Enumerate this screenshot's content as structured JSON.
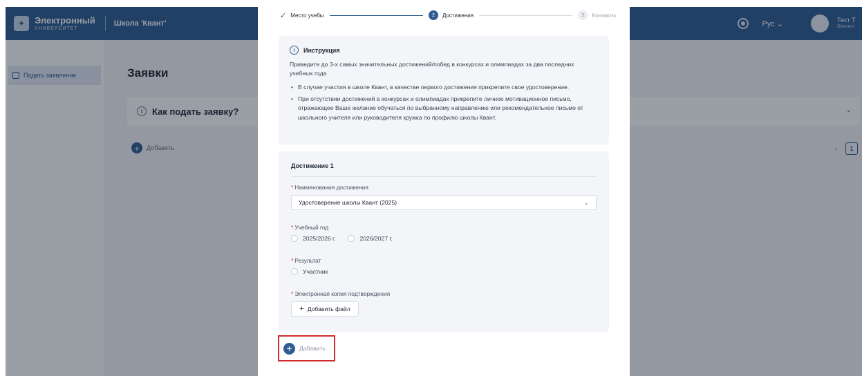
{
  "header": {
    "logo_title": "Электронный",
    "logo_subtitle": "УНИВЕРСИТЕТ",
    "school": "Школа 'Квант'",
    "language": "Рус ⌄",
    "user_name": "Тест Т",
    "user_sub": "Школьн"
  },
  "sidebar": {
    "items": [
      {
        "label": "Подать заявление"
      }
    ]
  },
  "background": {
    "page_title": "Заявки",
    "how_to_apply": "Как подать заявку?",
    "add_label": "Добавить",
    "pager_prev": "‹",
    "page_number": "1"
  },
  "stepper": {
    "steps": [
      {
        "label": "Место учебы",
        "state": "done"
      },
      {
        "number": "2",
        "label": "Достижения",
        "state": "active"
      },
      {
        "number": "3",
        "label": "Контакты",
        "state": "pending"
      }
    ]
  },
  "instructions": {
    "title": "Инструкция",
    "intro": "Приведите до 3-х самых значительных достижений/побед в конкурсах и олимпиадах за два последних учебных года",
    "bullets": [
      "В случае участия в школе Квант, в качестве первого достижения прикрепите свое удостоверение.",
      "При отсутствии достижений в конкурсах и олимпиадах прикрепите личное мотивационное письмо, отражающее Ваше желание обучаться по выбранному направлению или рекомендательное письмо от школьного учителя или руководителя кружка по профилю школы Квант."
    ]
  },
  "achievement": {
    "title": "Достижение 1",
    "name_label": "Наименования достижения",
    "name_value": "Удостоверение школы Квант (2025)",
    "year_label": "Учебный год",
    "year_options": [
      "2025/2026 г.",
      "2026/2027 г."
    ],
    "result_label": "Результат",
    "result_options": [
      "Участник"
    ],
    "file_label": "Электронная копия подтверждения",
    "file_button": "Добавить файл"
  },
  "add_button": {
    "label": "Добавить"
  },
  "colors": {
    "primary": "#2f5d93",
    "highlight": "#d12c2c",
    "required": "#d9363e"
  }
}
